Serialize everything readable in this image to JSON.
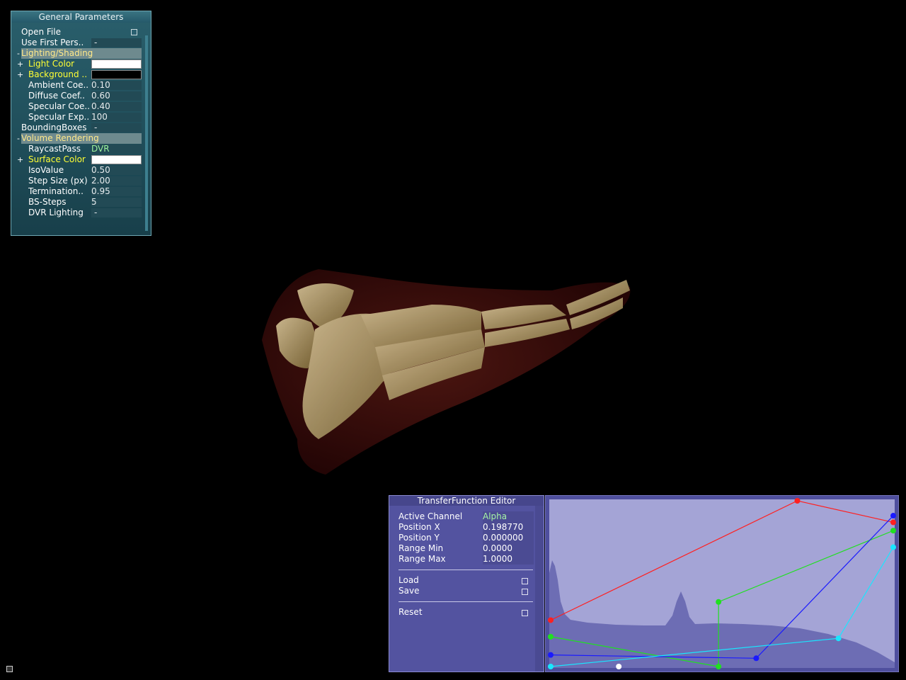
{
  "general": {
    "title": "General Parameters",
    "rows": [
      {
        "label": "Open File",
        "type": "checkbox"
      },
      {
        "label": "Use First Pers..",
        "value": "-"
      },
      {
        "label": "Lighting/Shading",
        "type": "group",
        "expander": "-"
      },
      {
        "label": "Light Color",
        "type": "color",
        "color": "#ffffff",
        "expander": "+"
      },
      {
        "label": "Background ..",
        "type": "color",
        "color": "#000000",
        "expander": "+"
      },
      {
        "label": "Ambient Coe..",
        "value": "0.10"
      },
      {
        "label": "Diffuse Coef..",
        "value": "0.60"
      },
      {
        "label": "Specular Coe..",
        "value": "0.40"
      },
      {
        "label": "Specular Exp..",
        "value": "100"
      },
      {
        "label": "BoundingBoxes",
        "value": "-"
      },
      {
        "label": "Volume Rendering",
        "type": "group",
        "expander": "-"
      },
      {
        "label": "RaycastPass",
        "value": "DVR"
      },
      {
        "label": "Surface Color",
        "type": "color",
        "color": "#ffffff",
        "expander": "+"
      },
      {
        "label": "IsoValue",
        "value": "0.50"
      },
      {
        "label": "Step Size (px)",
        "value": "2.00"
      },
      {
        "label": "Termination..",
        "value": "0.95"
      },
      {
        "label": "BS-Steps",
        "value": "5"
      },
      {
        "label": "DVR Lighting",
        "value": "-"
      }
    ]
  },
  "tfe": {
    "title": "TransferFunction Editor",
    "fields": [
      {
        "label": "Active Channel",
        "value": "Alpha"
      },
      {
        "label": "Position X",
        "value": "0.198770"
      },
      {
        "label": "Position Y",
        "value": "0.000000"
      },
      {
        "label": "Range Min",
        "value": "0.0000"
      },
      {
        "label": "Range Max",
        "value": "1.0000"
      }
    ],
    "buttons": {
      "load": "Load",
      "save": "Save",
      "reset": "Reset"
    }
  },
  "channels": {
    "red": {
      "color": "#ff2020",
      "points": [
        [
          0,
          0.28
        ],
        [
          0.72,
          1.0
        ],
        [
          1,
          0.87
        ]
      ]
    },
    "green": {
      "color": "#20e020",
      "points": [
        [
          0,
          0.18
        ],
        [
          0.49,
          0.0
        ],
        [
          0.49,
          0.39
        ],
        [
          1,
          0.82
        ]
      ]
    },
    "blue": {
      "color": "#1a1aff",
      "points": [
        [
          0,
          0.07
        ],
        [
          0.6,
          0.05
        ],
        [
          1,
          0.91
        ]
      ]
    },
    "cyan": {
      "color": "#19e6ff",
      "points": [
        [
          0,
          0.0
        ],
        [
          0.84,
          0.17
        ],
        [
          1,
          0.72
        ]
      ]
    },
    "alpha_point": {
      "x": 0.19877,
      "y": 0.0,
      "color": "#ffffff"
    }
  }
}
